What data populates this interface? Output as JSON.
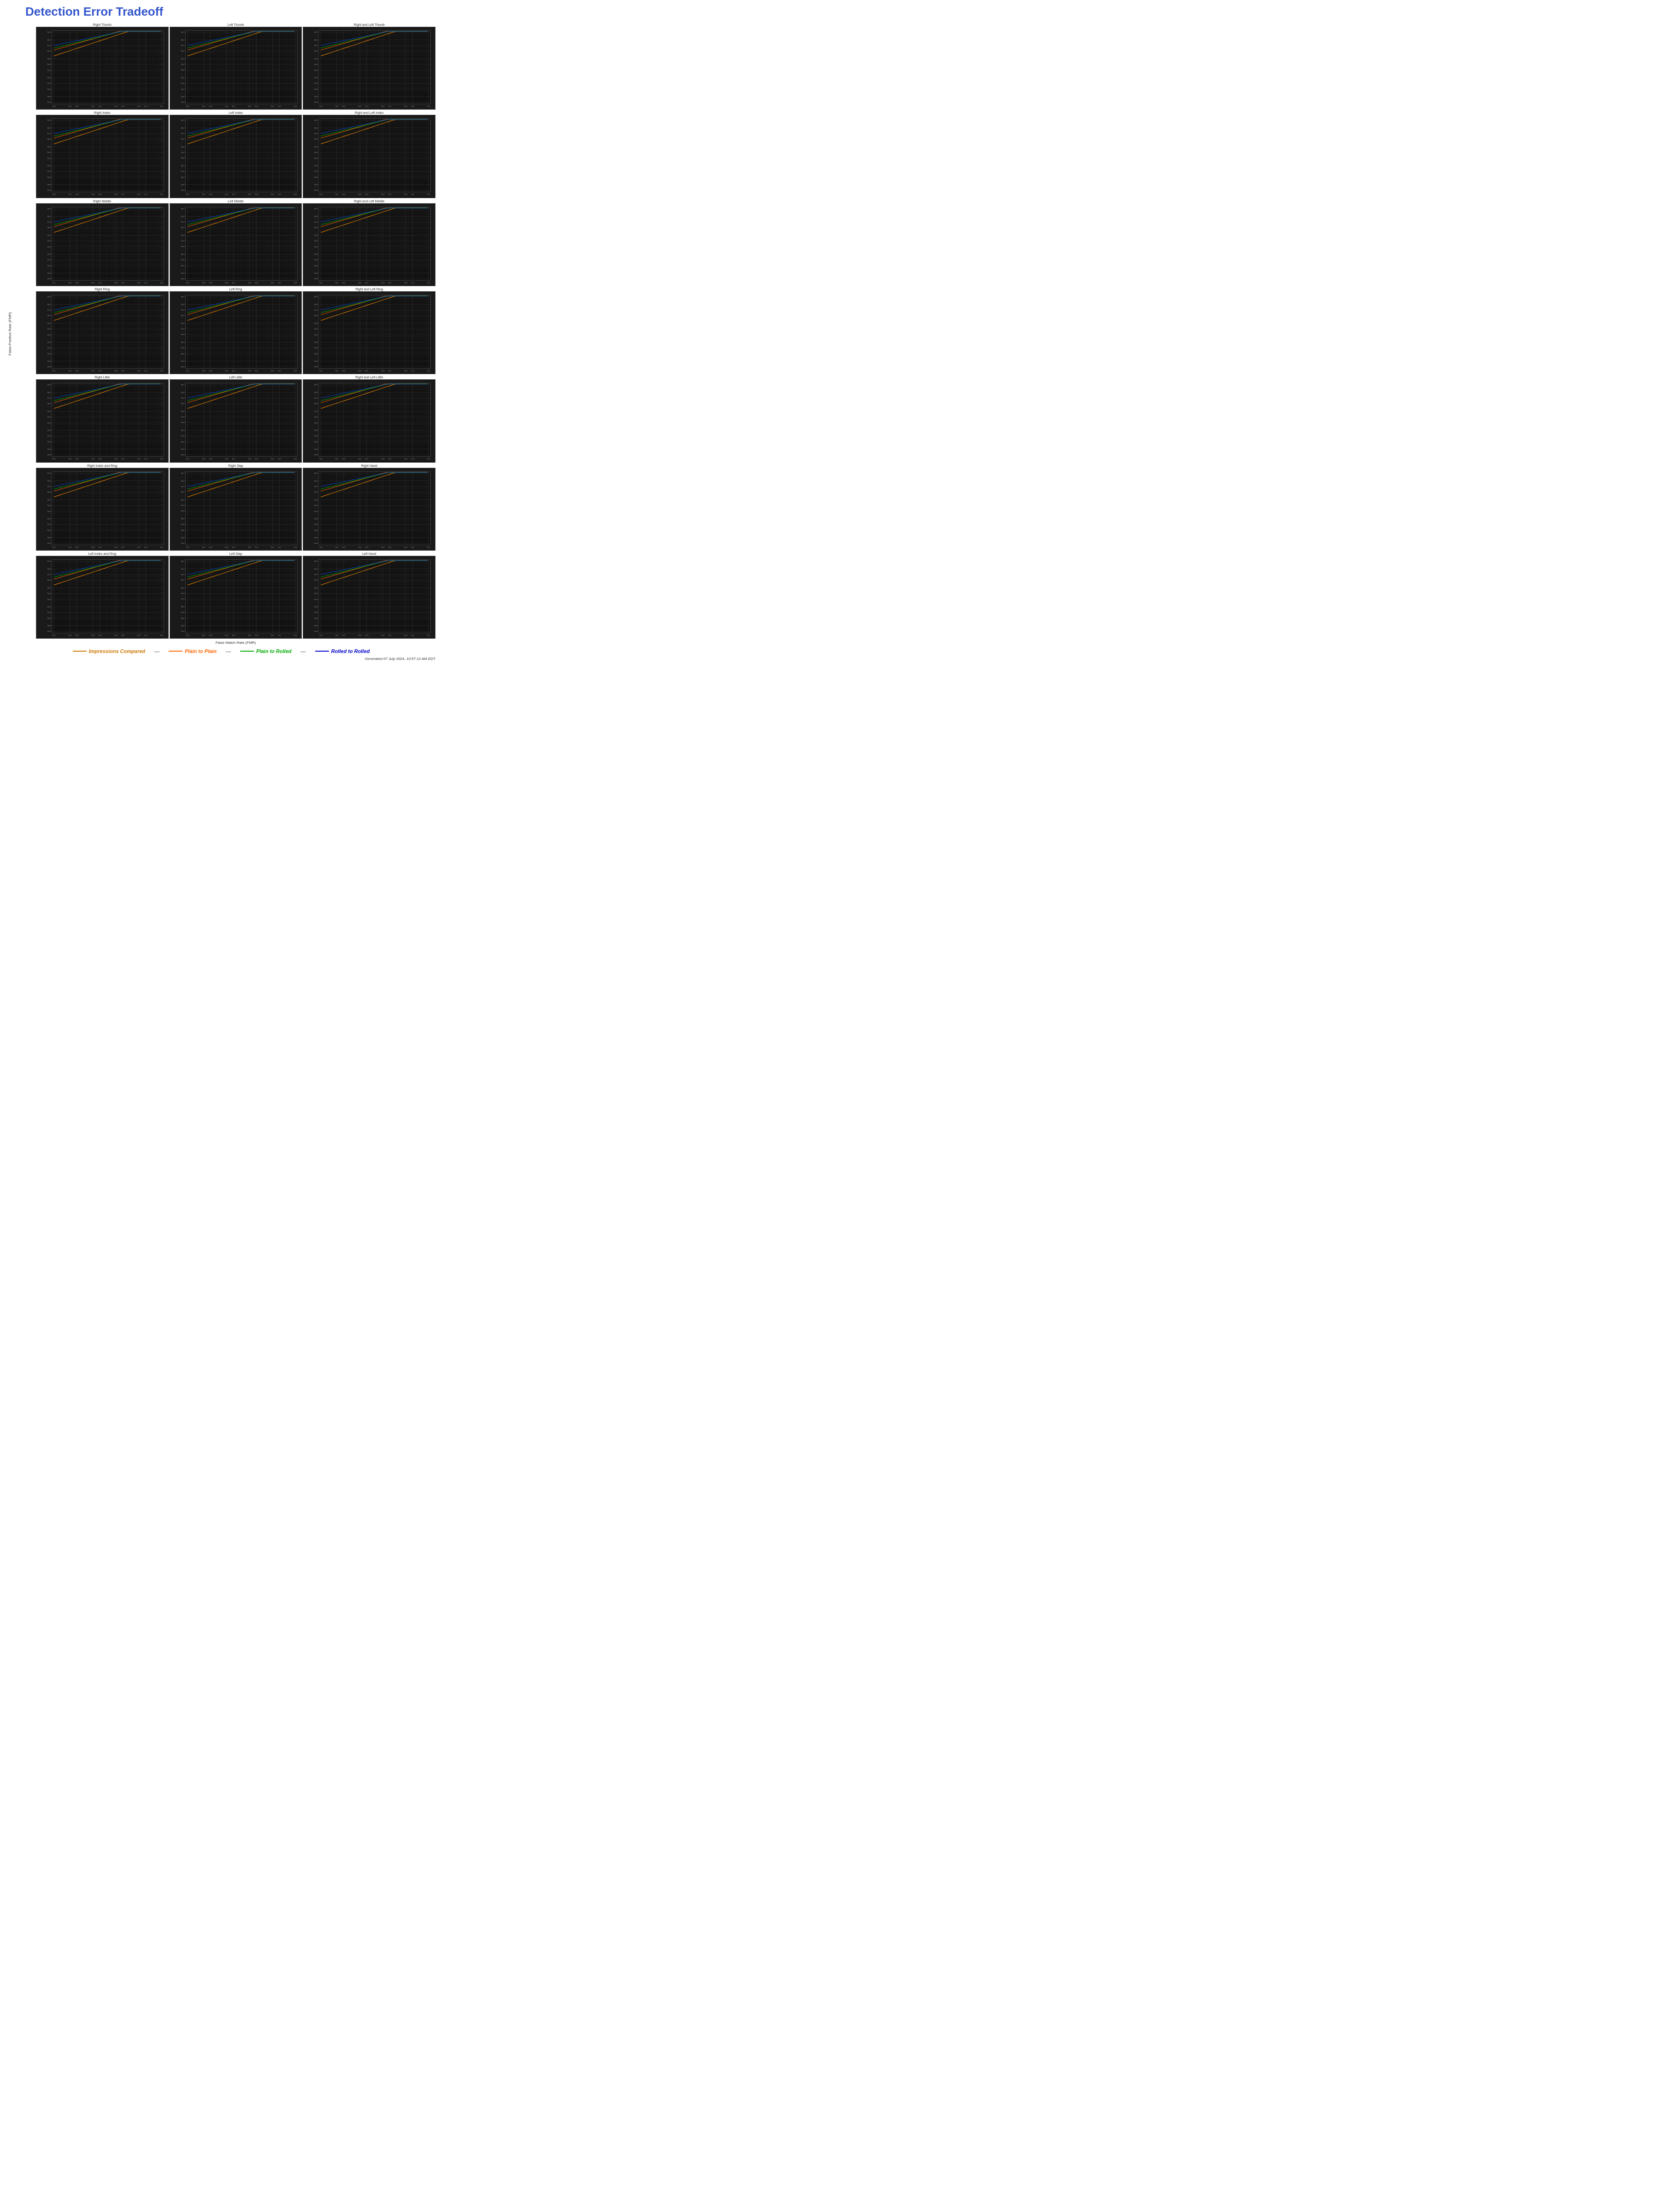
{
  "title": "Detection Error Tradeoff",
  "yAxisLabel": "False-Positive Rate (FMR)",
  "xAxisLabel": "False Match Rate (FMR)",
  "charts": [
    {
      "title": "Right Thumb",
      "row": 0,
      "col": 0
    },
    {
      "title": "Left Thumb",
      "row": 0,
      "col": 1
    },
    {
      "title": "Right and Left Thumb",
      "row": 0,
      "col": 2
    },
    {
      "title": "Right Index",
      "row": 1,
      "col": 0
    },
    {
      "title": "Left Index",
      "row": 1,
      "col": 1
    },
    {
      "title": "Right and Left Index",
      "row": 1,
      "col": 2
    },
    {
      "title": "Right Middle",
      "row": 2,
      "col": 0
    },
    {
      "title": "Left Middle",
      "row": 2,
      "col": 1
    },
    {
      "title": "Right and Left Middle",
      "row": 2,
      "col": 2
    },
    {
      "title": "Right Ring",
      "row": 3,
      "col": 0
    },
    {
      "title": "Left Ring",
      "row": 3,
      "col": 1
    },
    {
      "title": "Right and Left Ring",
      "row": 3,
      "col": 2
    },
    {
      "title": "Right Little",
      "row": 4,
      "col": 0
    },
    {
      "title": "Left Little",
      "row": 4,
      "col": 1
    },
    {
      "title": "Right and Left Little",
      "row": 4,
      "col": 2
    },
    {
      "title": "Right Index and Ring",
      "row": 5,
      "col": 0
    },
    {
      "title": "Right Slap",
      "row": 5,
      "col": 1
    },
    {
      "title": "Right Hand",
      "row": 5,
      "col": 2
    },
    {
      "title": "Left Index and Ring",
      "row": 6,
      "col": 0
    },
    {
      "title": "Left Slap",
      "row": 6,
      "col": 1
    },
    {
      "title": "Left Hand",
      "row": 6,
      "col": 2
    }
  ],
  "legend": {
    "items": [
      {
        "label": "Impressions Compared",
        "color": "#cc7700"
      },
      {
        "label": "Plain to Plain",
        "color": "#ff6600"
      },
      {
        "label": "Plain to Rolled",
        "color": "#00aa00"
      },
      {
        "label": "Rolled to Rolled",
        "color": "#0000cc"
      }
    ]
  },
  "generated": "Generated 07 July 2024, 10:57:12 AM EDT"
}
